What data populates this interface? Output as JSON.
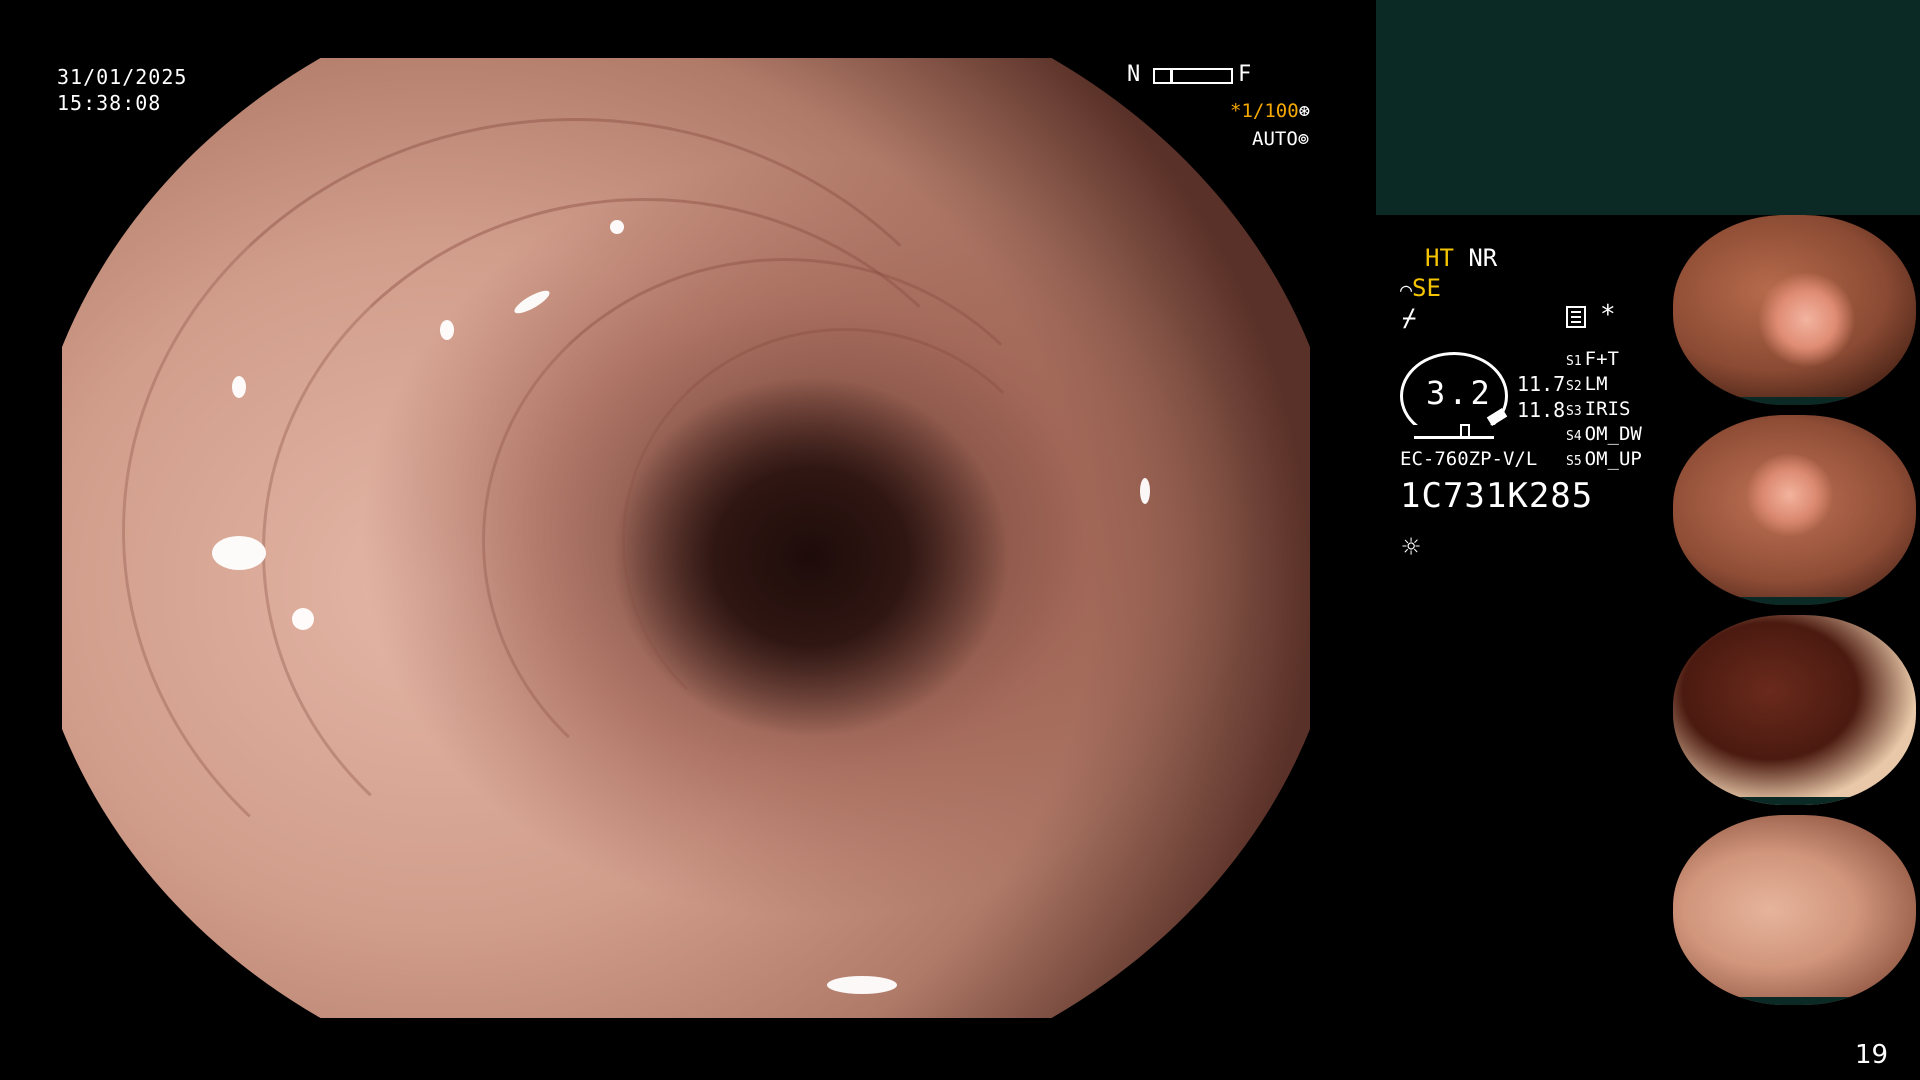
{
  "overlay": {
    "date": "31/01/2025",
    "time": "15:38:08",
    "near_label": "N",
    "far_label": "F",
    "shutter_speed": "*1/100",
    "shutter_icon": "aperture-icon",
    "iris_mode": "AUTO",
    "iris_icon": "iris-icon"
  },
  "status_panel": {
    "ht_label": "HT",
    "nr_label": "NR",
    "enhance_icon": "scope-icon",
    "se_label": "SE",
    "flash_icon": "lightning-icon",
    "notes_icon": "notes-icon",
    "asterisk": "*",
    "zoom_value": "3.2",
    "upper_value": "11.7",
    "lower_value": "11.8",
    "scope_model": "EC-760ZP-V/L",
    "serial_number": "1C731K285",
    "light_icon": "sun-icon",
    "presets": [
      {
        "key": "S1",
        "value": "F+T"
      },
      {
        "key": "S2",
        "value": "LM"
      },
      {
        "key": "S3",
        "value": "IRIS"
      },
      {
        "key": "S4",
        "value": "OM_DW"
      },
      {
        "key": "S5",
        "value": "OM_UP"
      }
    ]
  },
  "page_number": "19",
  "colors": {
    "background": "#000000",
    "panel_teal": "#0b2a26",
    "accent_yellow": "#f5c400",
    "accent_orange": "#f5a800"
  }
}
